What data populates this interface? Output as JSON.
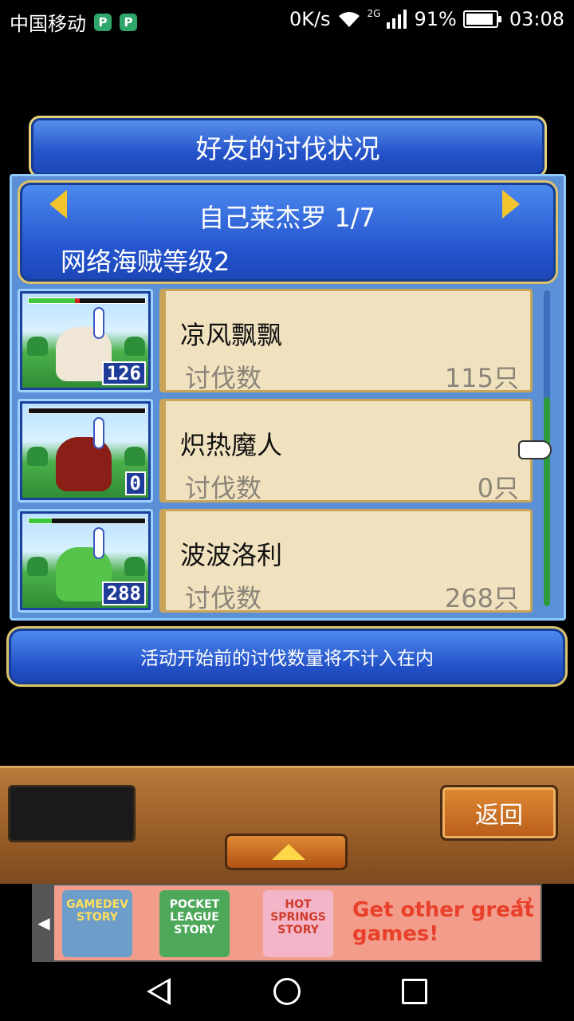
{
  "status_bar": {
    "carrier": "中国移动",
    "speed": "0K/s",
    "network": "2G",
    "battery": "91%",
    "battery_level": 0.91,
    "time": "03:08"
  },
  "dialog": {
    "title": "好友的讨伐状况",
    "player": "自己莱杰罗 1/7",
    "level_label": "网络海贼等级2",
    "notice": "活动开始前的讨伐数量将不计入在内"
  },
  "friends": [
    {
      "name": "凉风飘飘",
      "kill_label": "讨伐数",
      "kill_count": "115只",
      "monster_number": "126",
      "hp": 0.4,
      "damage": 0.04,
      "monster_color": "#efe6d6"
    },
    {
      "name": "炽热魔人",
      "kill_label": "讨伐数",
      "kill_count": "0只",
      "monster_number": "0",
      "hp": 0.0,
      "damage": 0.0,
      "monster_color": "#8a1f18"
    },
    {
      "name": "波波洛利",
      "kill_label": "讨伐数",
      "kill_count": "268只",
      "monster_number": "288",
      "hp": 0.2,
      "damage": 0.0,
      "monster_color": "#56c44a"
    }
  ],
  "bottom_bar": {
    "back_label": "返回"
  },
  "ad": {
    "games": [
      "GAMEDEV STORY",
      "POCKET LEAGUE STORY",
      "HOT SPRINGS STORY"
    ],
    "cta": "Get other great games!"
  },
  "icons": {
    "wifi": "wifi-icon",
    "signal": "signal-icon",
    "battery": "battery-icon",
    "prev": "arrow-left-icon",
    "next": "arrow-right-icon",
    "cursor": "pointing-hand-icon",
    "up": "arrow-up-icon"
  }
}
